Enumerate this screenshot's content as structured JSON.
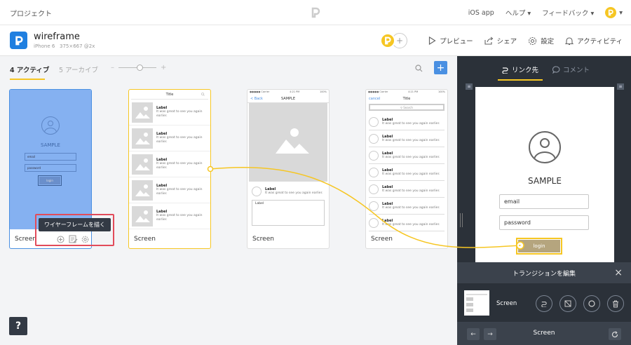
{
  "topbar": {
    "project_link": "プロジェクト",
    "ios_app": "iOS app",
    "help": "ヘルプ ▾",
    "feedback": "フィードバック ▾",
    "avatar_menu": "▾"
  },
  "project": {
    "name": "wireframe",
    "device": "iPhone 6",
    "size": "375×667 @2x",
    "actions": {
      "preview": "プレビュー",
      "share": "シェア",
      "settings": "設定",
      "activity": "アクティビティ"
    }
  },
  "tabs": {
    "active": "4 アクティブ",
    "archive": "5 アーカイブ",
    "zoom_minus": "–",
    "zoom_plus": "+",
    "add": "+"
  },
  "screens": [
    {
      "label": "Screen",
      "sample": "SAMPLE",
      "email": "email",
      "password": "password",
      "login": "login"
    },
    {
      "label": "Screen",
      "title": "Title",
      "row_label": "Label",
      "row_text": "It was great to see you again earlier."
    },
    {
      "label": "Screen",
      "status_carrier": "●●●●● Carrier",
      "status_time": "4:21 PM",
      "status_battery": "100%",
      "back": "< Back",
      "title": "SAMPLE",
      "row_label": "Label",
      "row_text": "It was great to see you again earlier.",
      "box_label": "Label"
    },
    {
      "label": "Screen",
      "status_carrier": "●●●●● Carrier",
      "status_time": "4:21 PM",
      "status_battery": "100%",
      "cancel": "cancel",
      "title": "Title",
      "search": "Search",
      "row_label": "Label",
      "row_text": "It was great to see you again earlier."
    }
  ],
  "tooltip": "ワイヤーフレームを描く",
  "help": "?",
  "right_panel": {
    "tab_links": "リンク先",
    "tab_comments": "コメント",
    "sample": "SAMPLE",
    "email": "email",
    "password": "password",
    "login": "login",
    "transition_title": "トランジションを編集",
    "transition_screen": "Screen",
    "bottom_screen": "Screen"
  },
  "colors": {
    "accent": "#f6c623",
    "primary_blue": "#4a90e2",
    "panel_dark": "#2b3139",
    "highlight_red": "#e24b5a"
  }
}
